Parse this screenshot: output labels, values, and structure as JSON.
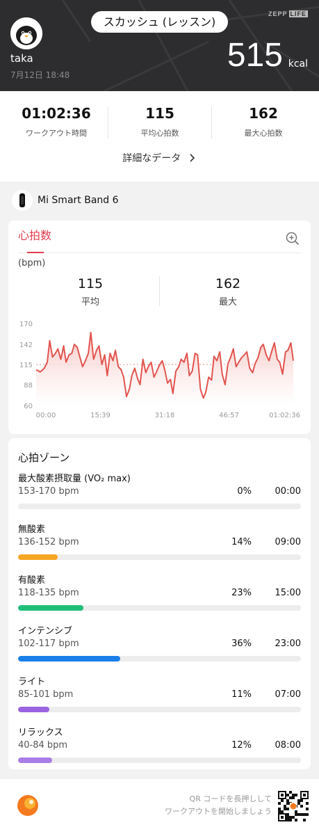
{
  "header": {
    "title": "スカッシュ (レッスン)",
    "brand": "ZEPP",
    "brand_tag": "LIFE",
    "username": "taka",
    "datetime": "7月12日 18:48",
    "calories": "515",
    "calories_unit": "kcal"
  },
  "summary": {
    "duration": {
      "value": "01:02:36",
      "label": "ワークアウト時間"
    },
    "avg_hr": {
      "value": "115",
      "label": "平均心拍数"
    },
    "max_hr": {
      "value": "162",
      "label": "最大心拍数"
    },
    "detail_link": "詳細なデータ",
    "detail_chevron": "chevron-right-icon"
  },
  "device": {
    "name": "Mi Smart Band 6",
    "icon": "band-icon"
  },
  "heart_rate": {
    "title": "心拍数",
    "unit": "(bpm)",
    "avg": {
      "value": "115",
      "label": "平均"
    },
    "max": {
      "value": "162",
      "label": "最大"
    },
    "zoom_icon": "zoom-in-icon",
    "line_color": "#e2544f"
  },
  "chart_data": {
    "type": "area",
    "title": "",
    "xlabel": "",
    "ylabel": "(bpm)",
    "y_ticks": [
      "170",
      "142",
      "115",
      "88",
      "60"
    ],
    "x_ticks": [
      "00:00",
      "15:39",
      "31:18",
      "46:57",
      "01:02:36"
    ],
    "ylim": [
      60,
      170
    ],
    "xlim": [
      0,
      62.6
    ],
    "reference_line": 115,
    "grid": false,
    "x": [
      0,
      1,
      2,
      2.7,
      3.3,
      4,
      4.7,
      5.3,
      6,
      6.7,
      7.3,
      8,
      8.7,
      9.3,
      10,
      10.7,
      11.3,
      12,
      12.7,
      13.3,
      14,
      14.7,
      15.3,
      16,
      16.7,
      17.3,
      18,
      18.7,
      19.3,
      20,
      20.7,
      21.3,
      22,
      22.7,
      23.3,
      24,
      24.7,
      25.3,
      26,
      26.7,
      27.3,
      28,
      28.7,
      29.3,
      30,
      30.7,
      31.3,
      32,
      32.7,
      33.3,
      34,
      34.7,
      35.3,
      36,
      36.7,
      37.3,
      38,
      38.7,
      39.3,
      40,
      40.7,
      41.3,
      42,
      42.7,
      43.3,
      44,
      44.7,
      45.3,
      46,
      46.7,
      47.3,
      48,
      48.7,
      49.3,
      50,
      50.7,
      51.3,
      52,
      52.7,
      53.3,
      54,
      54.7,
      55.3,
      56,
      56.7,
      57.3,
      58,
      58.7,
      59.3,
      60,
      60.7,
      61.3,
      62,
      62.6
    ],
    "y": [
      108,
      105,
      110,
      118,
      147,
      125,
      130,
      136,
      122,
      140,
      118,
      128,
      130,
      142,
      138,
      124,
      112,
      120,
      130,
      158,
      122,
      134,
      140,
      115,
      128,
      100,
      130,
      120,
      134,
      112,
      108,
      98,
      72,
      82,
      100,
      110,
      96,
      88,
      122,
      104,
      112,
      118,
      98,
      105,
      114,
      120,
      108,
      90,
      95,
      76,
      106,
      112,
      122,
      118,
      130,
      100,
      106,
      130,
      128,
      82,
      70,
      78,
      98,
      94,
      126,
      120,
      132,
      102,
      88,
      116,
      124,
      136,
      112,
      118,
      124,
      128,
      132,
      110,
      104,
      116,
      124,
      138,
      142,
      128,
      120,
      132,
      144,
      122,
      118,
      102,
      132,
      134,
      144,
      120
    ],
    "fill_gradient": [
      "#f6c7c4",
      "#ffffff"
    ]
  },
  "zones": {
    "title": "心拍ゾーン",
    "items": [
      {
        "name": "最大酸素摂取量 (VO₂ max)",
        "range": "153-170 bpm",
        "percent": "0%",
        "time": "00:00",
        "fraction": 0.0,
        "color": "#9b9b9b"
      },
      {
        "name": "無酸素",
        "range": "136-152 bpm",
        "percent": "14%",
        "time": "09:00",
        "fraction": 0.14,
        "color": "#f5a623"
      },
      {
        "name": "有酸素",
        "range": "118-135 bpm",
        "percent": "23%",
        "time": "15:00",
        "fraction": 0.23,
        "color": "#1fbf78"
      },
      {
        "name": "インテンシブ",
        "range": "102-117 bpm",
        "percent": "36%",
        "time": "23:00",
        "fraction": 0.36,
        "color": "#1a7fe8"
      },
      {
        "name": "ライト",
        "range": "85-101 bpm",
        "percent": "11%",
        "time": "07:00",
        "fraction": 0.11,
        "color": "#9a64e0"
      },
      {
        "name": "リラックス",
        "range": "40-84 bpm",
        "percent": "12%",
        "time": "08:00",
        "fraction": 0.12,
        "color": "#a97de6"
      }
    ]
  },
  "footer": {
    "qr_line1": "QR コードを長押しして",
    "qr_line2": "ワークアウトを開始しましょう",
    "logo_icon": "zepp-logo-icon",
    "qr_icon": "qr-code-icon"
  }
}
